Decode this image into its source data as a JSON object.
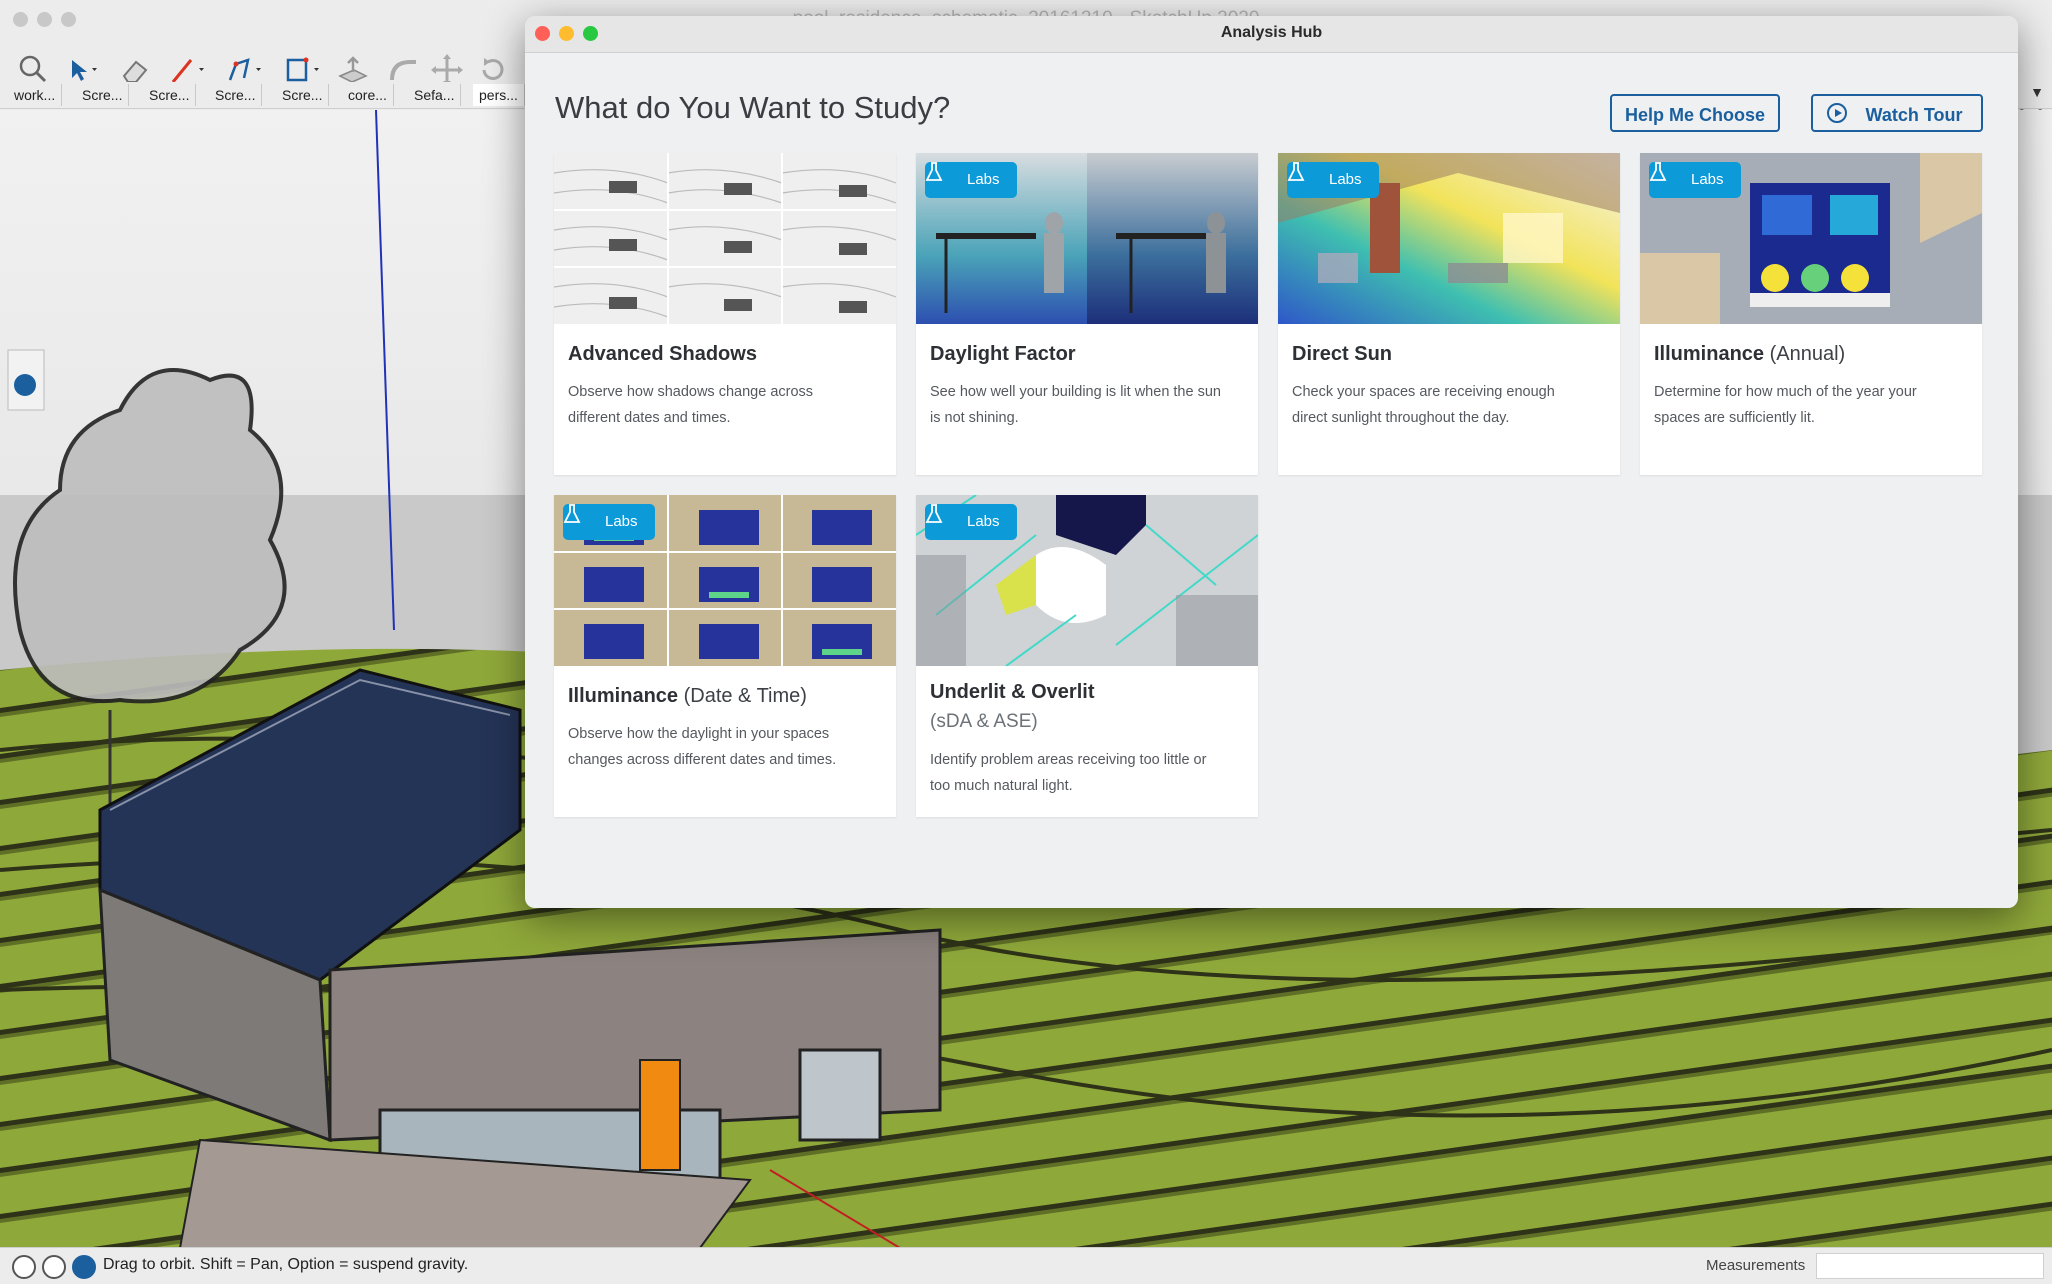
{
  "main_window": {
    "title": "pool_residence_schematic_20161210 - SketchUp 2020",
    "scene_tabs": [
      "work...",
      "Scre...",
      "Scre...",
      "Scre...",
      "Scre...",
      "core...",
      "Sefa...",
      "pers..."
    ],
    "active_tab_index": 7,
    "tab_overflow_icon": "triangle-down-icon",
    "tools": [
      "search-icon",
      "select-arrow-icon",
      "eraser-icon",
      "pencil-line-icon",
      "polyline-icon",
      "rectangle-icon",
      "push-pull-icon",
      "follow-me-icon",
      "move-icon",
      "rotate-icon"
    ],
    "status_hint": "Drag to orbit. Shift = Pan, Option = suspend gravity.",
    "measurements_label": "Measurements",
    "measurements_value": ""
  },
  "dialog": {
    "title": "Analysis Hub",
    "heading": "What do You Want to Study?",
    "help_button": "Help Me Choose",
    "tour_button": "Watch Tour",
    "labs_label": "Labs",
    "cards": [
      {
        "title": "Advanced Shadows",
        "title_light": "",
        "subtitle": "",
        "desc": "Observe how shadows change across different dates and times.",
        "labs": false
      },
      {
        "title": "Daylight Factor",
        "title_light": "",
        "subtitle": "",
        "desc": "See how well your building is lit when the sun is not shining.",
        "labs": true
      },
      {
        "title": "Direct Sun",
        "title_light": "",
        "subtitle": "",
        "desc": "Check your spaces are receiving enough direct sunlight throughout the day.",
        "labs": true
      },
      {
        "title": "Illuminance",
        "title_light": " (Annual)",
        "subtitle": "",
        "desc": "Determine for how much of the year your spaces are sufficiently lit.",
        "labs": true
      },
      {
        "title": "Illuminance",
        "title_light": " (Date & Time)",
        "subtitle": "",
        "desc": "Observe how the daylight in your spaces changes across different dates and times.",
        "labs": true
      },
      {
        "title": "Underlit & Overlit",
        "title_light": "",
        "subtitle": "(sDA & ASE)",
        "desc": "Identify problem areas receiving too little or too much natural light.",
        "labs": true
      }
    ]
  },
  "colors": {
    "accent": "#1b5f9e",
    "labs_badge": "#0d9ad8",
    "terrain": "#8fa83a",
    "close": "#fe5f57",
    "minimize": "#febc2e",
    "zoom": "#28c840"
  }
}
